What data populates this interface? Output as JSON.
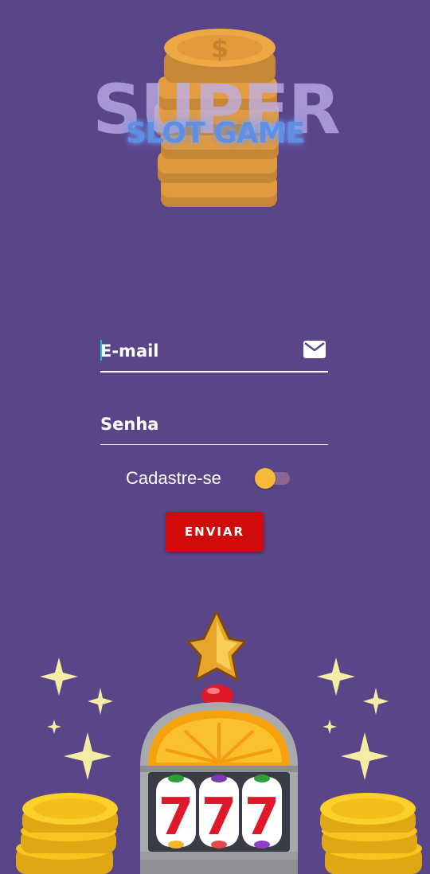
{
  "logo": {
    "title": "SUPER",
    "subtitle": "SLOT GAME",
    "coin_symbol": "$"
  },
  "form": {
    "email_placeholder": "E-mail",
    "email_value": "",
    "password_placeholder": "Senha",
    "password_value": "",
    "register_label": "Cadastre-se",
    "register_toggle_on": false,
    "submit_label": "ENVIAR"
  },
  "slot": {
    "reels": [
      "7",
      "7",
      "7"
    ]
  },
  "colors": {
    "background": "#5b4589",
    "button": "#d10b0b",
    "toggle_thumb": "#f7b93a",
    "accent_caret": "#18c1c6",
    "subtitle": "#5f8ee2"
  },
  "icons": {
    "email": "envelope-icon",
    "decorations": [
      "star-icon",
      "sparkle-icon",
      "coin-stack-icon",
      "slot-machine-icon"
    ]
  }
}
